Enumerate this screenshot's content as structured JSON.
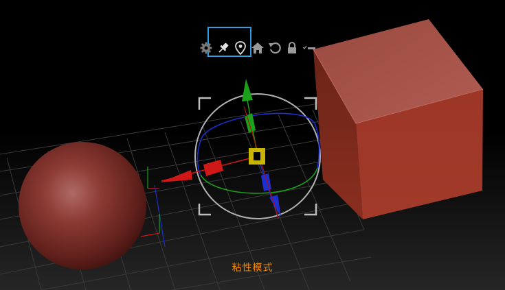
{
  "viewport": {
    "mode_label": "粘性模式"
  },
  "toolbar": {
    "items": [
      {
        "icon": "gear-icon",
        "state": "normal"
      },
      {
        "icon": "pin-icon",
        "state": "active"
      },
      {
        "icon": "location-pin-icon",
        "state": "active"
      },
      {
        "icon": "home-icon",
        "state": "normal"
      },
      {
        "icon": "reset-icon",
        "state": "normal"
      },
      {
        "icon": "lock-icon",
        "state": "normal"
      },
      {
        "icon": "options-dropdown-icon",
        "state": "normal"
      }
    ]
  },
  "colors": {
    "x_axis": "#d01818",
    "y_axis": "#1aa01a",
    "z_axis": "#1c2fd0",
    "center_handle": "#c9b400",
    "mode_label": "#f08c00",
    "selection_frame": "#2f9de0",
    "object_color": "#8a2e22"
  }
}
